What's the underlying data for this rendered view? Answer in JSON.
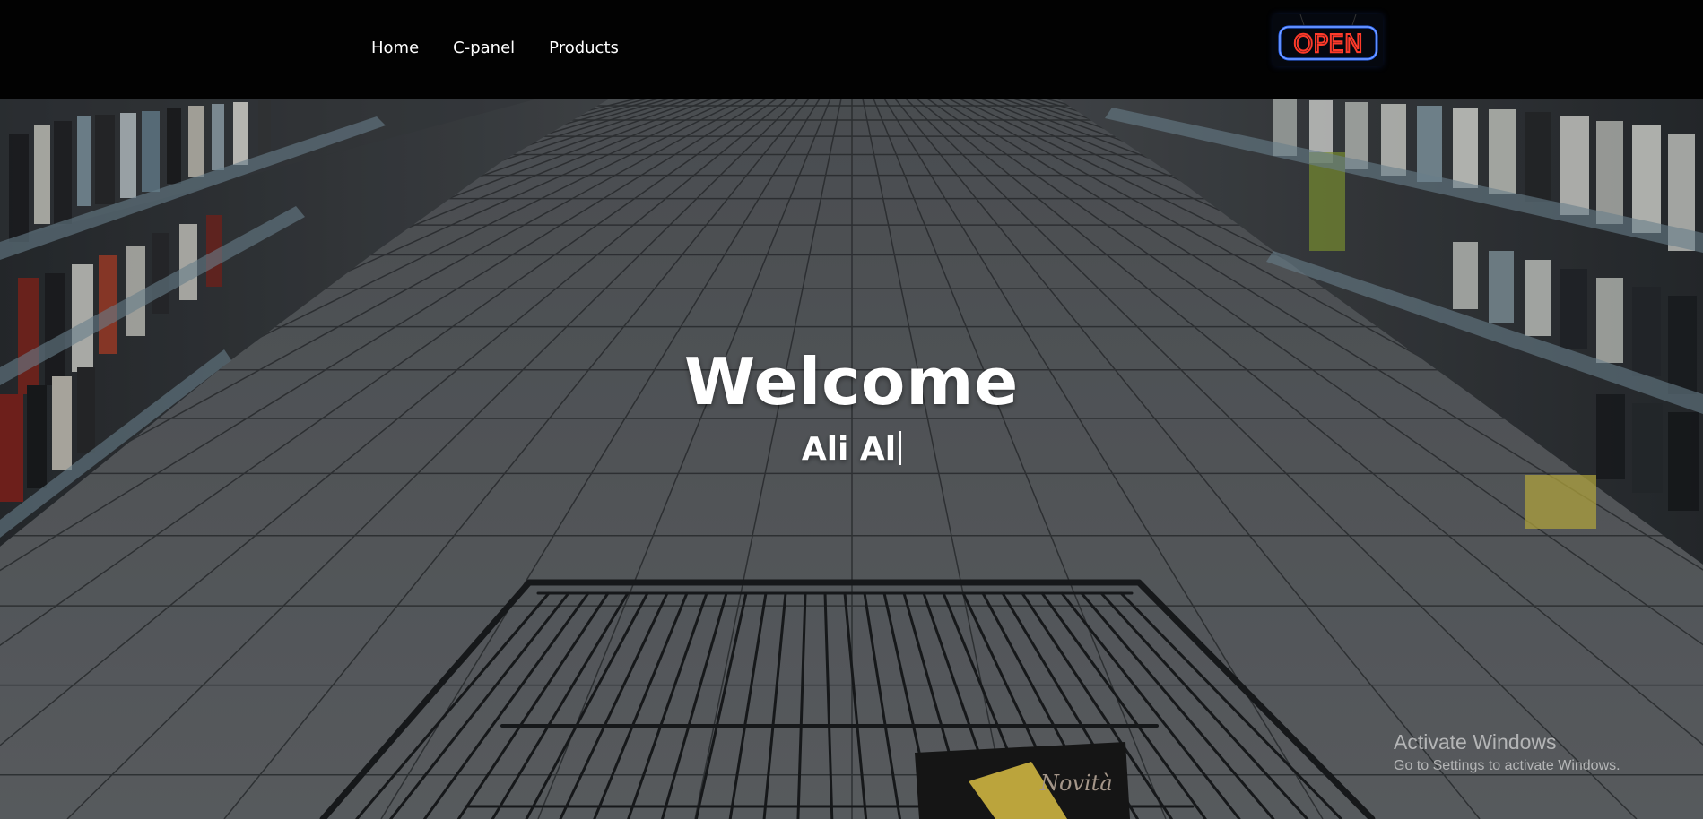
{
  "nav": {
    "items": [
      {
        "label": "Home"
      },
      {
        "label": "C-panel"
      },
      {
        "label": "Products"
      }
    ],
    "sign_text": "OPEN",
    "sign_icon": "open-neon-sign-icon"
  },
  "hero": {
    "title": "Welcome",
    "subtitle": "Ali Al",
    "background": "supermarket-aisle-with-shopping-cart"
  },
  "watermark": {
    "title": "Activate Windows",
    "subtitle": "Go to Settings to activate Windows."
  },
  "colors": {
    "navbar_bg": "#020202",
    "nav_text": "#ffffff",
    "hero_text": "#ffffff",
    "sign_red": "#ff3a2a",
    "sign_blue": "#2f6bff"
  }
}
